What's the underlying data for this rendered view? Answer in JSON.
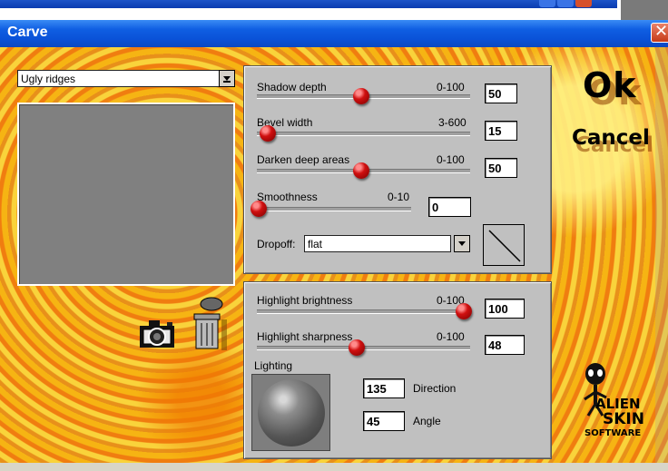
{
  "window": {
    "title": "Carve",
    "close_glyph": "✕"
  },
  "preset": {
    "value": "Ugly ridges"
  },
  "sliders": [
    {
      "label": "Shadow depth",
      "range": "0-100",
      "value": "50"
    },
    {
      "label": "Bevel width",
      "range": "3-600",
      "value": "15"
    },
    {
      "label": "Darken deep areas",
      "range": "0-100",
      "value": "50"
    },
    {
      "label": "Smoothness",
      "range": "0-10",
      "value": "0"
    }
  ],
  "dropoff": {
    "label": "Dropoff:",
    "value": "flat"
  },
  "highlight": [
    {
      "label": "Highlight brightness",
      "range": "0-100",
      "value": "100"
    },
    {
      "label": "Highlight sharpness",
      "range": "0-100",
      "value": "48"
    }
  ],
  "lighting": {
    "label": "Lighting",
    "direction_value": "135",
    "direction_label": "Direction",
    "angle_value": "45",
    "angle_label": "Angle"
  },
  "buttons": {
    "ok": "Ok",
    "cancel": "Cancel"
  },
  "icons": {
    "camera": "camera-icon",
    "trash": "trash-can-icon",
    "logo": "alien-skin-logo"
  },
  "logo": {
    "line1": "ALIEN",
    "line2": "SKIN",
    "line3": "SOFTWARE"
  },
  "colors": {
    "titlebar": "#0a52d8",
    "panel": "#c0c0c0",
    "knob": "#d01010",
    "background": "#f2a516"
  }
}
